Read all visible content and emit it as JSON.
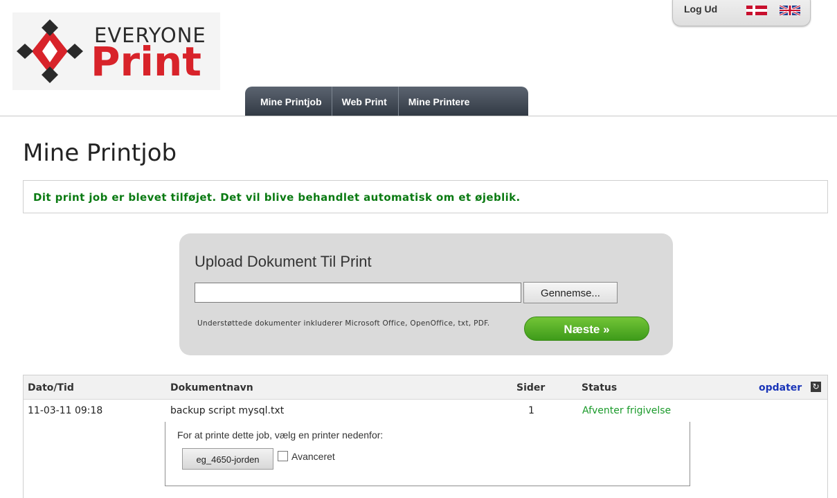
{
  "header": {
    "logo_top": "EVERYONE",
    "logo_bottom": "Print",
    "logout_label": "Log Ud",
    "flags": [
      "danish-flag-icon",
      "uk-flag-icon"
    ],
    "nav": [
      {
        "label": "Mine Printjob"
      },
      {
        "label": "Web Print"
      },
      {
        "label": "Mine Printere"
      }
    ]
  },
  "main": {
    "title": "Mine Printjob",
    "notice": "Dit print job er blevet tilføjet. Det vil blive behandlet automatisk om et øjeblik.",
    "upload": {
      "title": "Upload Dokument Til Print",
      "file_value": "",
      "browse_label": "Gennemse...",
      "supported_text": "Understøttede dokumenter inkluderer Microsoft Office, OpenOffice, txt, PDF.",
      "next_label": "Næste »"
    },
    "table": {
      "columns": [
        "Dato/Tid",
        "Dokumentnavn",
        "Sider",
        "Status"
      ],
      "refresh_label": "opdater",
      "refresh_icon": "refresh-icon",
      "rows": [
        {
          "date": "11-03-11 09:18",
          "document": "backup script mysql.txt",
          "pages": "1",
          "status": "Afventer frigivelse"
        }
      ],
      "printer_prompt": "For at printe dette job, vælg en printer nedenfor:",
      "printer_button": "eg_4650-jorden",
      "advanced_label": "Avanceret",
      "advanced_checked": false
    }
  },
  "colors": {
    "brand_red": "#d8232a",
    "notice_green": "#0a7a12",
    "status_green": "#1a9a2a",
    "link_blue": "#1a35b8",
    "nav_dark": "#323a44"
  }
}
